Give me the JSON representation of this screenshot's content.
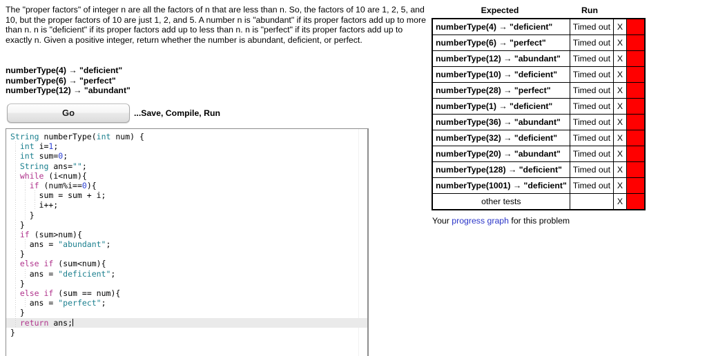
{
  "problem": {
    "description": "The \"proper factors\" of integer n are all the factors of n that are less than n. So, the factors of 10 are 1, 2, 5, and 10, but the proper factors of 10 are just 1, 2, and 5. A number n is \"abundant\" if its proper factors add up to more than n. n is \"deficient\" if its proper factors add up to less than n. n is \"perfect\" if its proper factors add up to exactly n. Given a positive integer, return whether the number is abundant, deficient, or perfect.",
    "examples": [
      "numberType(4) → \"deficient\"",
      "numberType(6) → \"perfect\"",
      "numberType(12) → \"abundant\""
    ]
  },
  "toolbar": {
    "go_label": "Go",
    "hint": "...Save, Compile, Run"
  },
  "editor": {
    "lines": [
      [
        {
          "t": "String",
          "c": "tok-type"
        },
        {
          "t": " numberType(",
          "c": "tok-pl"
        },
        {
          "t": "int",
          "c": "tok-type"
        },
        {
          "t": " num) {",
          "c": "tok-pl"
        }
      ],
      [
        {
          "t": "  ",
          "c": "tok-pl"
        },
        {
          "t": "int",
          "c": "tok-type"
        },
        {
          "t": " i=",
          "c": "tok-pl"
        },
        {
          "t": "1",
          "c": "tok-num"
        },
        {
          "t": ";",
          "c": "tok-pl"
        }
      ],
      [
        {
          "t": "  ",
          "c": "tok-pl"
        },
        {
          "t": "int",
          "c": "tok-type"
        },
        {
          "t": " sum=",
          "c": "tok-pl"
        },
        {
          "t": "0",
          "c": "tok-num"
        },
        {
          "t": ";",
          "c": "tok-pl"
        }
      ],
      [
        {
          "t": "  ",
          "c": "tok-pl"
        },
        {
          "t": "String",
          "c": "tok-type"
        },
        {
          "t": " ans=",
          "c": "tok-pl"
        },
        {
          "t": "\"\"",
          "c": "tok-str"
        },
        {
          "t": ";",
          "c": "tok-pl"
        }
      ],
      [
        {
          "t": "  ",
          "c": "tok-pl"
        },
        {
          "t": "while",
          "c": "tok-kw"
        },
        {
          "t": " (i<num){",
          "c": "tok-pl"
        }
      ],
      [
        {
          "t": "    ",
          "c": "tok-pl"
        },
        {
          "t": "if",
          "c": "tok-kw"
        },
        {
          "t": " (num%i==",
          "c": "tok-pl"
        },
        {
          "t": "0",
          "c": "tok-num"
        },
        {
          "t": "){",
          "c": "tok-pl"
        }
      ],
      [
        {
          "t": "      sum = sum + i;",
          "c": "tok-pl"
        }
      ],
      [
        {
          "t": "      i++;",
          "c": "tok-pl"
        }
      ],
      [
        {
          "t": "    }",
          "c": "tok-pl"
        }
      ],
      [
        {
          "t": "  }",
          "c": "tok-pl"
        }
      ],
      [
        {
          "t": "  ",
          "c": "tok-pl"
        },
        {
          "t": "if",
          "c": "tok-kw"
        },
        {
          "t": " (sum>num){",
          "c": "tok-pl"
        }
      ],
      [
        {
          "t": "    ans = ",
          "c": "tok-pl"
        },
        {
          "t": "\"abundant\"",
          "c": "tok-str"
        },
        {
          "t": ";",
          "c": "tok-pl"
        }
      ],
      [
        {
          "t": "  }",
          "c": "tok-pl"
        }
      ],
      [
        {
          "t": "  ",
          "c": "tok-pl"
        },
        {
          "t": "else",
          "c": "tok-kw"
        },
        {
          "t": " ",
          "c": "tok-pl"
        },
        {
          "t": "if",
          "c": "tok-kw"
        },
        {
          "t": " (sum<num){",
          "c": "tok-pl"
        }
      ],
      [
        {
          "t": "    ans = ",
          "c": "tok-pl"
        },
        {
          "t": "\"deficient\"",
          "c": "tok-str"
        },
        {
          "t": ";",
          "c": "tok-pl"
        }
      ],
      [
        {
          "t": "  }",
          "c": "tok-pl"
        }
      ],
      [
        {
          "t": "  ",
          "c": "tok-pl"
        },
        {
          "t": "else",
          "c": "tok-kw"
        },
        {
          "t": " ",
          "c": "tok-pl"
        },
        {
          "t": "if",
          "c": "tok-kw"
        },
        {
          "t": " (sum == num){",
          "c": "tok-pl"
        }
      ],
      [
        {
          "t": "    ans = ",
          "c": "tok-pl"
        },
        {
          "t": "\"perfect\"",
          "c": "tok-str"
        },
        {
          "t": ";",
          "c": "tok-pl"
        }
      ],
      [
        {
          "t": "  }",
          "c": "tok-pl"
        }
      ],
      [
        {
          "t": "  ",
          "c": "tok-pl"
        },
        {
          "t": "return",
          "c": "tok-kw"
        },
        {
          "t": " ans;",
          "c": "tok-pl"
        }
      ],
      [
        {
          "t": "}",
          "c": "tok-pl"
        }
      ]
    ],
    "active_line_index": 19
  },
  "results": {
    "headers": {
      "expected": "Expected",
      "run": "Run"
    },
    "fail_color": "#ff0000",
    "rows": [
      {
        "expected": "numberType(4) → \"deficient\"",
        "run": "Timed out",
        "mark": "X",
        "status": "fail"
      },
      {
        "expected": "numberType(6) → \"perfect\"",
        "run": "Timed out",
        "mark": "X",
        "status": "fail"
      },
      {
        "expected": "numberType(12) → \"abundant\"",
        "run": "Timed out",
        "mark": "X",
        "status": "fail"
      },
      {
        "expected": "numberType(10) → \"deficient\"",
        "run": "Timed out",
        "mark": "X",
        "status": "fail"
      },
      {
        "expected": "numberType(28) → \"perfect\"",
        "run": "Timed out",
        "mark": "X",
        "status": "fail"
      },
      {
        "expected": "numberType(1) → \"deficient\"",
        "run": "Timed out",
        "mark": "X",
        "status": "fail"
      },
      {
        "expected": "numberType(36) → \"abundant\"",
        "run": "Timed out",
        "mark": "X",
        "status": "fail"
      },
      {
        "expected": "numberType(32) → \"deficient\"",
        "run": "Timed out",
        "mark": "X",
        "status": "fail"
      },
      {
        "expected": "numberType(20) → \"abundant\"",
        "run": "Timed out",
        "mark": "X",
        "status": "fail"
      },
      {
        "expected": "numberType(128) → \"deficient\"",
        "run": "Timed out",
        "mark": "X",
        "status": "fail"
      },
      {
        "expected": "numberType(1001) → \"deficient\"",
        "run": "Timed out",
        "mark": "X",
        "status": "fail"
      },
      {
        "expected": "other tests",
        "run": "",
        "mark": "X",
        "status": "fail",
        "other": true
      }
    ]
  },
  "progress": {
    "prefix": "Your ",
    "link": "progress graph",
    "suffix": " for this problem"
  }
}
